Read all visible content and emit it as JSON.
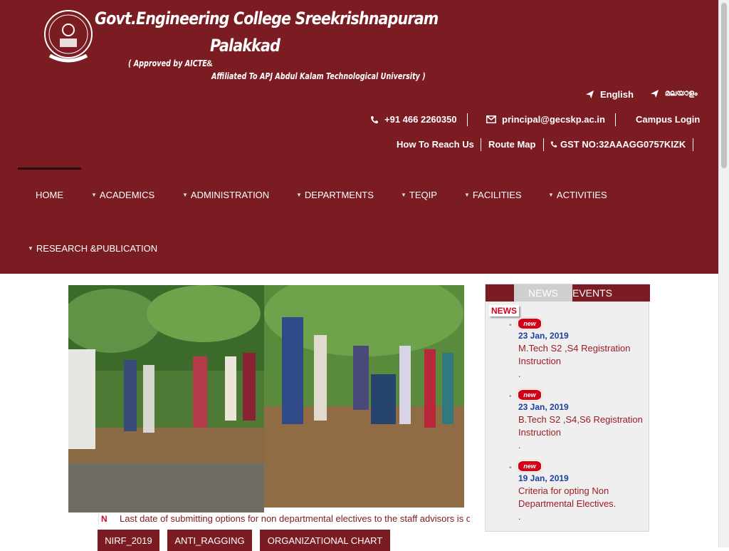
{
  "header": {
    "title_line1": "Govt.Engineering College Sreekrishnapuram",
    "title_line2": "Palakkad",
    "approved": "( Approved by AICTE",
    "amp": "&",
    "affiliated": "Affiliated To APJ Abdul Kalam Technological University )",
    "logo_icon": "college-seal-logo"
  },
  "topbar": {
    "lang_english": "English",
    "lang_malayalam": "മലയാളം",
    "phone": "+91 466 2260350",
    "email": "principal@gecskp.ac.in",
    "campus_login": "Campus Login",
    "how_to_reach": "How To Reach Us",
    "route_map": "Route Map",
    "gst": "GST NO:32AAAGG0757KIZK"
  },
  "nav": {
    "items": [
      {
        "label": "HOME"
      },
      {
        "label": "ACADEMICS"
      },
      {
        "label": "ADMINISTRATION"
      },
      {
        "label": "DEPARTMENTS"
      },
      {
        "label": "TEQIP"
      },
      {
        "label": "FACILITIES"
      },
      {
        "label": "ACTIVITIES"
      },
      {
        "label": "RESEARCH &PUBLICATION"
      }
    ]
  },
  "ticker": {
    "icon": "N",
    "text": "Last date of submitting options for non departmental electives to the staff advisors is on"
  },
  "buttons": {
    "nirf": "NIRF_2019",
    "anti_ragging": "ANTI_RAGGING",
    "org_chart": "ORGANIZATIONAL CHART"
  },
  "news_panel": {
    "tab_news": "NEWS",
    "tab_events": "EVENTS",
    "label": "NEWS",
    "badge": "new",
    "items": [
      {
        "date": "23 Jan, 2019",
        "title": "M.Tech S2 ,S4 Registration Instruction",
        "dot": "."
      },
      {
        "date": "23 Jan, 2019",
        "title": "B.Tech S2 ,S4,S6 Registration Instruction",
        "dot": "."
      },
      {
        "date": "19 Jan, 2019",
        "title": "Criteria for opting Non Departmental Electives.",
        "dot": "."
      }
    ]
  },
  "colors": {
    "brand": "#7b1b22",
    "news_date": "#1a3fa0",
    "news_link": "#9b1c25"
  }
}
